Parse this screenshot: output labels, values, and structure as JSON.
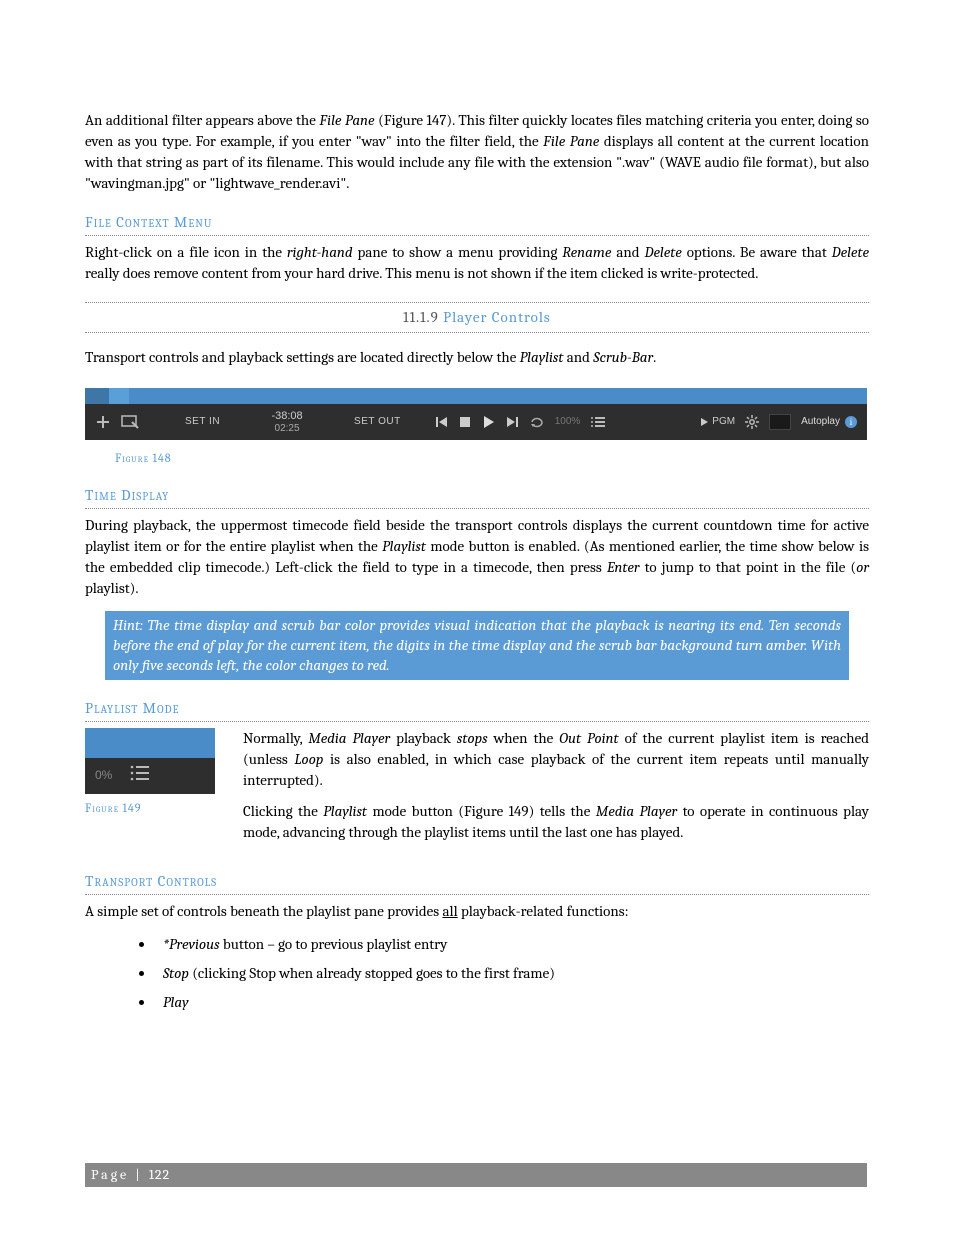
{
  "intro_para_a": "An additional filter appears above the ",
  "intro_file_pane": "File Pane",
  "intro_para_b": " (Figure 147).  This filter quickly locates files matching criteria you enter, doing so even as you type.  For example, if you enter \"wav\" into the filter field, the ",
  "intro_para_c": " displays all content at the current location with that string as part of its filename.  This would include any file with the extension \".wav\" (WAVE audio file format), but also \"wavingman.jpg\" or \"lightwave_render.avi\".",
  "file_ctx_heading": "File Context Menu",
  "file_ctx_a": "Right-click on a file icon in the ",
  "file_ctx_rh": "right-hand",
  "file_ctx_b": " pane to show a menu providing ",
  "file_ctx_rename": "Rename",
  "file_ctx_c": " and ",
  "file_ctx_delete": "Delete",
  "file_ctx_d": " options.  Be aware that ",
  "file_ctx_e": " really does remove content from your hard drive.  This menu is not shown if the item clicked is write-protected.",
  "section_num": "11.1.9",
  "section_title": "Player Controls",
  "transport_intro_a": "Transport controls and playback settings are located directly below the ",
  "word_playlist": "Playlist",
  "transport_intro_b": " and ",
  "word_scrubbar": "Scrub-Bar",
  "period": ".",
  "fig148": {
    "caption": "Figure 148",
    "set_in": "SET IN",
    "time_top": "-38:08",
    "time_bot": "02:25",
    "set_out": "SET OUT",
    "percent": "100%",
    "pgm": "PGM",
    "autoplay": "Autoplay"
  },
  "time_display_heading": "Time Display",
  "time_display_a": "During playback, the uppermost timecode field beside the transport controls displays the current countdown time for active playlist item or for the entire playlist when the ",
  "time_display_b": " mode button is enabled.  (As mentioned earlier, the time show below is the embedded clip timecode.)  Left-click the field to type in a timecode, then press ",
  "word_enter": "Enter",
  "time_display_c": " to jump to that point in the file (",
  "word_or": "or",
  "time_display_d": " playlist).",
  "hint": "Hint: The time display and scrub bar color provides visual indication that the playback is nearing its end.  Ten seconds before the end of play for the current item, the digits in the time display and the scrub bar background turn amber.   With only five seconds left, the color changes to red.",
  "playlist_mode_heading": "Playlist Mode",
  "fig149": {
    "caption": "Figure 149",
    "percent": "0%"
  },
  "pm_a": "Normally, ",
  "word_media_player": "Media Player",
  "pm_b": " playback ",
  "word_stops": "stops",
  "pm_c": " when the ",
  "word_out_point": "Out Point",
  "pm_d": " of the current playlist item is reached (unless ",
  "word_loop": "Loop",
  "pm_e": " is also enabled, in which case playback of the current item repeats until manually interrupted).",
  "pm2_a": "Clicking the ",
  "pm2_b": " mode button (Figure 149) tells the ",
  "pm2_c": " to operate in continuous play mode, advancing through the playlist items until the last one has played.",
  "tc_heading": "Transport Controls",
  "tc_intro_a": "A simple set of controls beneath the playlist pane provides ",
  "tc_all": "all",
  "tc_intro_b": " playback-related functions:",
  "tc_items": {
    "prev_a": "*Previous",
    "prev_b": " button – go to previous playlist entry",
    "stop_a": "Stop",
    "stop_b": " (clicking Stop when already stopped goes to the first frame)",
    "play": "Play"
  },
  "footer_label": "Page",
  "footer_sep": " | ",
  "footer_num": "122"
}
